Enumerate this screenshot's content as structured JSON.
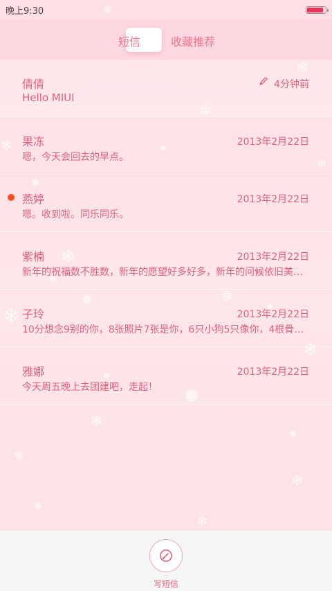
{
  "status_bar": {
    "time": "晚上9:30",
    "battery_level": 0.9
  },
  "header": {
    "tabs": [
      {
        "label": "短信",
        "active": true
      },
      {
        "label": "收藏推荐",
        "active": false
      }
    ]
  },
  "conversations": [
    {
      "name": "倩倩",
      "preview": "Hello MIUI",
      "time": "4分钟前",
      "draft": true,
      "unread": false
    },
    {
      "name": "果冻",
      "preview": "嗯，今天会回去的早点。",
      "time": "2013年2月22日",
      "draft": false,
      "unread": false
    },
    {
      "name": "燕婷",
      "preview": "嗯。收到啦。同乐同乐。",
      "time": "2013年2月22日",
      "draft": false,
      "unread": true
    },
    {
      "name": "紫楠",
      "preview": "新年的祝福数不胜数，新年的愿望好多好多，新年的问候依旧美好…",
      "time": "2013年2月22日",
      "draft": false,
      "unread": false
    },
    {
      "name": "子玲",
      "preview": "10分想念9别的你，8张照片7张是你，6只小狗5只像你，4根骨头…",
      "time": "2013年2月22日",
      "draft": false,
      "unread": false
    },
    {
      "name": "雅娜",
      "preview": "今天周五晚上去团建吧，走起！",
      "time": "2013年2月22日",
      "draft": false,
      "unread": false
    }
  ],
  "bottom_bar": {
    "compose_label": "写短信",
    "compose_icon": "compose-icon"
  },
  "colors": {
    "accent": "#e2607a",
    "unread": "#ff4d1f",
    "header_bg": "#fdd8e0",
    "battery": "#e8365b"
  }
}
